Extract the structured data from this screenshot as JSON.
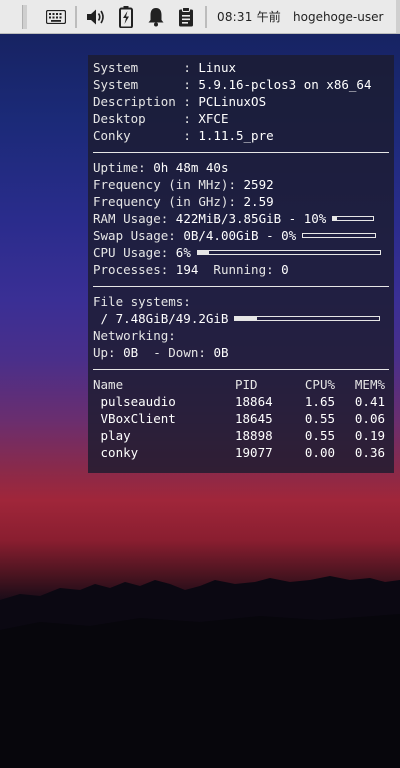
{
  "taskbar": {
    "clock": "08:31 午前",
    "user": "hogehoge-user",
    "icons": [
      "keyboard-icon",
      "volume-icon",
      "battery-charging-icon",
      "notification-bell-icon",
      "clipboard-icon"
    ]
  },
  "conky": {
    "sysinfo": [
      {
        "key": "System     ",
        "value": "Linux"
      },
      {
        "key": "System     ",
        "value": "5.9.16-pclos3 on x86_64"
      },
      {
        "key": "Description",
        "value": "PCLinuxOS"
      },
      {
        "key": "Desktop    ",
        "value": "XFCE"
      },
      {
        "key": "Conky      ",
        "value": "1.11.5_pre"
      }
    ],
    "uptime_label": "Uptime: ",
    "uptime": "0h 48m 40s",
    "freq_mhz_label": "Frequency (in MHz): ",
    "freq_mhz": "2592",
    "freq_ghz_label": "Frequency (in GHz): ",
    "freq_ghz": "2.59",
    "ram_label": "RAM Usage: ",
    "ram_value": "422MiB/3.85GiB - 10%",
    "ram_fraction": 0.1,
    "swap_label": "Swap Usage: ",
    "swap_value": "0B/4.00GiB - 0%",
    "swap_fraction": 0,
    "cpu_label": "CPU Usage: ",
    "cpu_value": "6%",
    "cpu_fraction": 0.06,
    "processes_label": "Processes: ",
    "processes": "194",
    "running_label": "  Running: ",
    "running": "0",
    "fs_label": "File systems:",
    "fs_value": " / 7.48GiB/49.2GiB",
    "fs_fraction": 0.15,
    "net_label": "Networking:",
    "up_label": "Up: ",
    "up_value": "0B",
    "down_label": "  - Down: ",
    "down_value": "0B",
    "table": {
      "headers": {
        "name": "Name",
        "pid": "PID",
        "cpu": "CPU%",
        "mem": "MEM%"
      },
      "rows": [
        {
          "name": " pulseaudio",
          "pid": "18864",
          "cpu": "1.65",
          "mem": "0.41"
        },
        {
          "name": " VBoxClient",
          "pid": "18645",
          "cpu": "0.55",
          "mem": "0.06"
        },
        {
          "name": " play",
          "pid": "18898",
          "cpu": "0.55",
          "mem": "0.19"
        },
        {
          "name": " conky",
          "pid": "19077",
          "cpu": "0.00",
          "mem": "0.36"
        }
      ]
    }
  }
}
